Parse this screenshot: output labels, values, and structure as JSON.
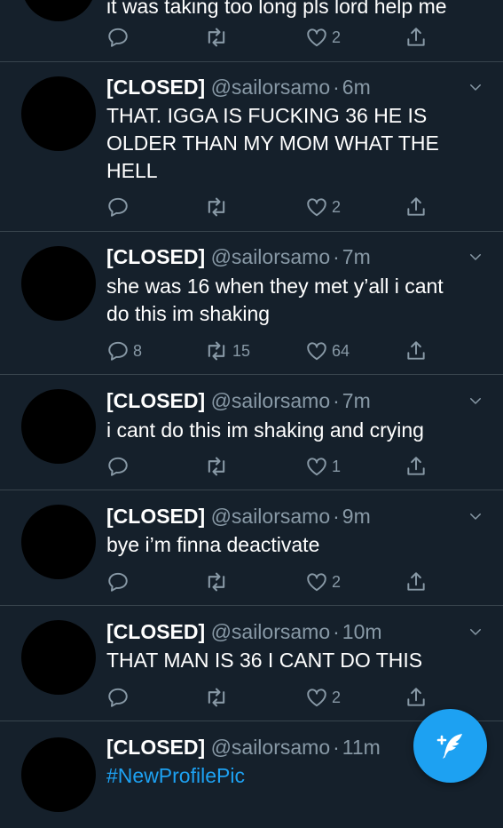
{
  "partial_tweet": {
    "text": "it was taking too long pls lord help me",
    "likes": "2"
  },
  "tweets": [
    {
      "name": "[CLOSED]",
      "handle": "@sailorsamo",
      "separator": "·",
      "time": "6m",
      "text": "THAT. IGGA IS FUCKING 36 HE IS\nOLDER THAN MY MOM WHAT THE\nHELL",
      "replies": "",
      "retweets": "",
      "likes": "2"
    },
    {
      "name": "[CLOSED]",
      "handle": "@sailorsamo",
      "separator": "·",
      "time": "7m",
      "text": "she was 16 when they met y’all i cant\ndo this im shaking",
      "replies": "8",
      "retweets": "15",
      "likes": "64"
    },
    {
      "name": "[CLOSED]",
      "handle": "@sailorsamo",
      "separator": "·",
      "time": "7m",
      "text": "i cant do this im shaking and crying",
      "replies": "",
      "retweets": "",
      "likes": "1"
    },
    {
      "name": "[CLOSED]",
      "handle": "@sailorsamo",
      "separator": "·",
      "time": "9m",
      "text": "bye i’m finna deactivate",
      "replies": "",
      "retweets": "",
      "likes": "2"
    },
    {
      "name": "[CLOSED]",
      "handle": "@sailorsamo",
      "separator": "·",
      "time": "10m",
      "text": "THAT MAN IS 36 I CANT DO THIS",
      "replies": "",
      "retweets": "",
      "likes": "2"
    },
    {
      "name": "[CLOSED]",
      "handle": "@sailorsamo",
      "separator": "·",
      "time": "11m",
      "text": "#NewProfilePic",
      "replies": "",
      "retweets": "",
      "likes": ""
    }
  ],
  "compose_button": {
    "icon": "compose-tweet-icon"
  },
  "colors": {
    "background": "#15202b",
    "divider": "#38444d",
    "secondary_text": "#8899a6",
    "accent": "#1da1f2"
  }
}
